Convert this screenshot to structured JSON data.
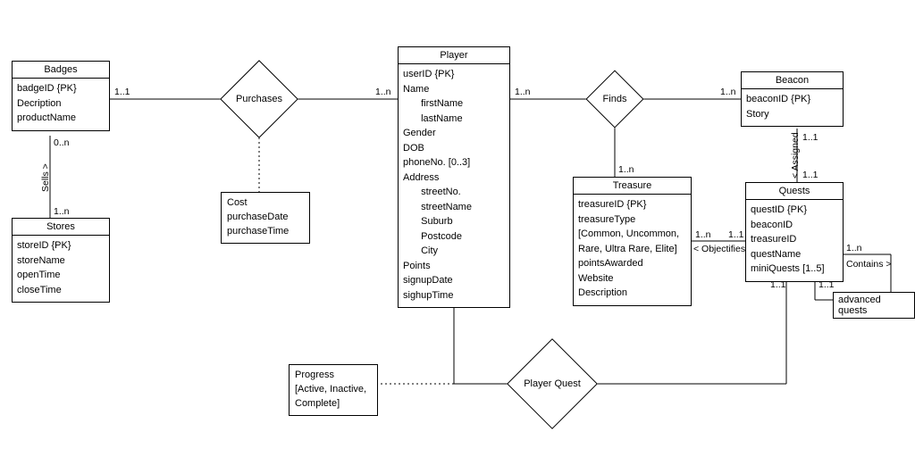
{
  "entities": {
    "badges": {
      "title": "Badges",
      "attrs": [
        "badgeID {PK}",
        "Decription",
        "productName"
      ]
    },
    "stores": {
      "title": "Stores",
      "attrs": [
        "storeID {PK}",
        "storeName",
        "openTime",
        "closeTime"
      ]
    },
    "player": {
      "title": "Player",
      "attrs": [
        "userID {PK}",
        "Name",
        "  firstName",
        "  lastName",
        "Gender",
        "DOB",
        "phoneNo. [0..3]",
        "Address",
        "  streetNo.",
        "  streetName",
        "  Suburb",
        "  Postcode",
        "  City",
        "Points",
        "signupDate",
        "sighupTime"
      ]
    },
    "treasure": {
      "title": "Treasure",
      "attrs": [
        "treasureID {PK}",
        "treasureType",
        "[Common, Uncommon,",
        "Rare, Ultra Rare, Elite]",
        "pointsAwarded",
        "Website",
        "Description"
      ]
    },
    "beacon": {
      "title": "Beacon",
      "attrs": [
        "beaconID {PK}",
        "Story"
      ]
    },
    "quests": {
      "title": "Quests",
      "attrs": [
        "questID {PK}",
        "beaconID",
        "treasureID",
        "questName",
        "miniQuests [1..5]"
      ]
    }
  },
  "relationships": {
    "purchases": {
      "label": "Purchases",
      "attrs": [
        "Cost",
        "purchaseDate",
        "purchaseTime"
      ]
    },
    "finds": {
      "label": "Finds"
    },
    "playerquest": {
      "label": "Player Quest",
      "attrs": [
        "Progress",
        "[Active, Inactive,",
        "Complete]"
      ]
    }
  },
  "edge_labels": {
    "sells": "Sells >",
    "assigned": "< Assigned",
    "objectifies": "< Objectifies",
    "contains": "Contains >",
    "advquests": "advanced quests"
  },
  "cardinalities": {
    "c1": "1..1",
    "c2": "1..n",
    "c3": "1..n",
    "c4": "1..n",
    "c5": "1..n",
    "c6": "1..n",
    "c7": "1..1",
    "c8": "1..1",
    "c9": "1..n",
    "c10": "1..1",
    "c11": "0..n",
    "c12": "1..n",
    "c13": "1..1",
    "c14": "1..n"
  }
}
